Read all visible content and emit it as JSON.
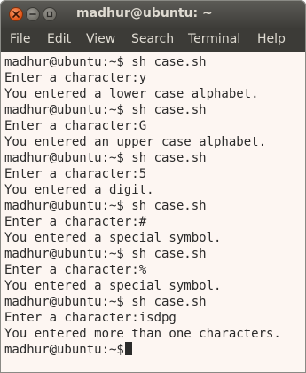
{
  "window": {
    "title": "madhur@ubuntu: ~",
    "controls": {
      "close_icon": "close-icon",
      "minimize_icon": "minimize-icon",
      "maximize_icon": "maximize-icon"
    }
  },
  "menu": [
    "File",
    "Edit",
    "View",
    "Search",
    "Terminal",
    "Help"
  ],
  "terminal": {
    "lines": [
      "madhur@ubuntu:~$ sh case.sh",
      "Enter a character:y",
      "You entered a lower case alphabet.",
      "madhur@ubuntu:~$ sh case.sh",
      "Enter a character:G",
      "You entered an upper case alphabet.",
      "madhur@ubuntu:~$ sh case.sh",
      "Enter a character:5",
      "You entered a digit.",
      "madhur@ubuntu:~$ sh case.sh",
      "Enter a character:#",
      "You entered a special symbol.",
      "madhur@ubuntu:~$ sh case.sh",
      "Enter a character:%",
      "You entered a special symbol.",
      "madhur@ubuntu:~$ sh case.sh",
      "Enter a character:isdpg",
      "You entered more than one characters.",
      "madhur@ubuntu:~$"
    ]
  },
  "colors": {
    "titlebar": "#3e3d39",
    "menubar": "#3c3b37",
    "menu_text": "#dfdbd2",
    "terminal_bg": "#fdf6f2",
    "terminal_text": "#2b2b2b",
    "close_button": "#e25313"
  }
}
